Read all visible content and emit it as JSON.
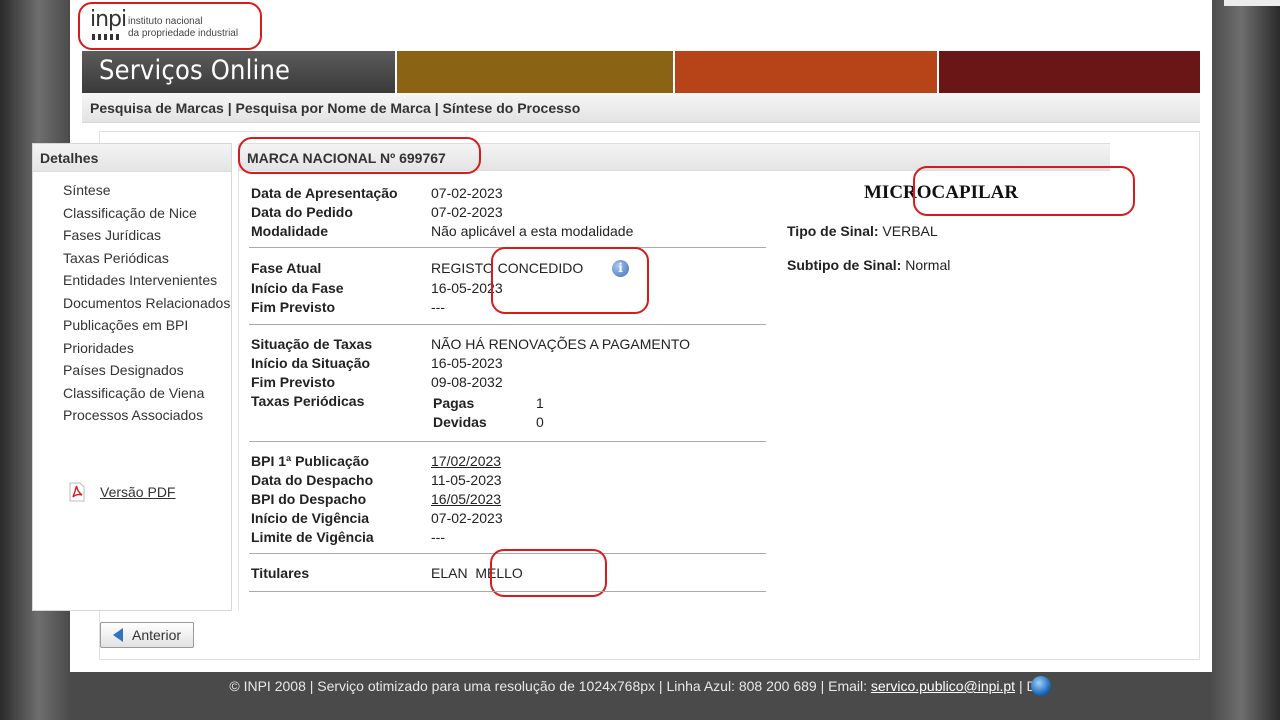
{
  "logo": {
    "word": "inpi",
    "line1": "instituto nacional",
    "line2": "da propriedade industrial"
  },
  "banner": {
    "title": "Serviços Online"
  },
  "breadcrumb": {
    "text": "Pesquisa de Marcas | Pesquisa por Nome de Marca | Síntese do Processo"
  },
  "sidebar": {
    "title": "Detalhes",
    "items": [
      "Síntese",
      "Classificação de Nice",
      "Fases Jurídicas",
      "Taxas Periódicas",
      "Entidades Intervenientes",
      "Documentos Relacionados",
      "Publicações em BPI",
      "Prioridades",
      "Países Designados",
      "Classificação de Viena",
      "Processos Associados"
    ],
    "pdf_label": "Versão PDF"
  },
  "main": {
    "title": "MARCA NACIONAL Nº 699767",
    "brand_name": "MICROCAPILAR",
    "tipo_sinal": {
      "label": "Tipo de Sinal:",
      "value": "VERBAL"
    },
    "subtipo_sinal": {
      "label": "Subtipo de Sinal:",
      "value": "Normal"
    },
    "block1": [
      {
        "label": "Data de Apresentação",
        "value": "07-02-2023"
      },
      {
        "label": "Data do Pedido",
        "value": "07-02-2023"
      },
      {
        "label": "Modalidade",
        "value": "Não aplicável a esta modalidade"
      }
    ],
    "block2": [
      {
        "label": "Fase Atual",
        "value": "REGISTO CONCEDIDO"
      },
      {
        "label": "Início da Fase",
        "value": "16-05-2023"
      },
      {
        "label": "Fim Previsto",
        "value": "---"
      }
    ],
    "block3": [
      {
        "label": "Situação de Taxas",
        "value": "NÃO HÁ RENOVAÇÕES A PAGAMENTO"
      },
      {
        "label": "Início da Situação",
        "value": "16-05-2023"
      },
      {
        "label": "Fim Previsto",
        "value": "09-08-2032"
      },
      {
        "label": "Taxas Periódicas",
        "value": ""
      }
    ],
    "taxas": [
      {
        "label": "Pagas",
        "value": "1"
      },
      {
        "label": "Devidas",
        "value": "0"
      }
    ],
    "block4": [
      {
        "label": "BPI 1ª Publicação",
        "value": "17/02/2023"
      },
      {
        "label": "Data do Despacho",
        "value": "11-05-2023"
      },
      {
        "label": "BPI do Despacho",
        "value": "16/05/2023"
      },
      {
        "label": "Início de Vigência",
        "value": "07-02-2023"
      },
      {
        "label": "Limite de Vigência",
        "value": "---"
      }
    ],
    "block5": [
      {
        "label": "Titulares",
        "value": "ELAN  MELLO"
      }
    ],
    "info_icon_glyph": "i"
  },
  "buttons": {
    "back": "Anterior"
  },
  "footer": {
    "text": "© INPI 2008 | Serviço otimizado para uma resolução de 1024x768px | Linha Azul: 808 200 689 | Email: ",
    "email": "servico.publico@inpi.pt",
    "tail": " | D"
  }
}
